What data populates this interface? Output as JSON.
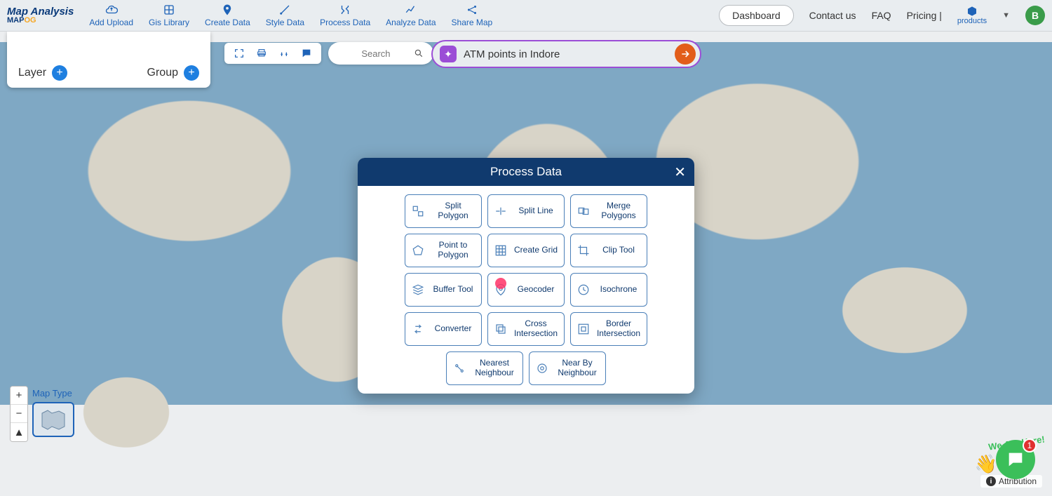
{
  "brand": {
    "title": "Map Analysis",
    "sub_a": "MAP",
    "sub_b": "OG"
  },
  "nav": {
    "items": [
      {
        "label": "Add Upload"
      },
      {
        "label": "Gis Library"
      },
      {
        "label": "Create Data"
      },
      {
        "label": "Style Data"
      },
      {
        "label": "Process Data"
      },
      {
        "label": "Analyze Data"
      },
      {
        "label": "Share Map"
      }
    ],
    "dashboard": "Dashboard",
    "contact": "Contact us",
    "faq": "FAQ",
    "pricing": "Pricing |",
    "products": "products",
    "avatar_letter": "B"
  },
  "sidebar": {
    "layer": "Layer",
    "group": "Group"
  },
  "toolbar": {
    "search_placeholder": "Search",
    "nl_value": "ATM points in Indore"
  },
  "map": {
    "maptype_label": "Map Type",
    "attribution": "Attribution"
  },
  "chat": {
    "badge": "1",
    "here_text": "We Are Here!"
  },
  "modal": {
    "title": "Process Data",
    "tools": [
      "Split Polygon",
      "Split Line",
      "Merge Polygons",
      "Point to Polygon",
      "Create Grid",
      "Clip Tool",
      "Buffer Tool",
      "Geocoder",
      "Isochrone",
      "Converter",
      "Cross Intersection",
      "Border Intersection",
      "Nearest Neighbour",
      "Near By Neighbour"
    ]
  }
}
